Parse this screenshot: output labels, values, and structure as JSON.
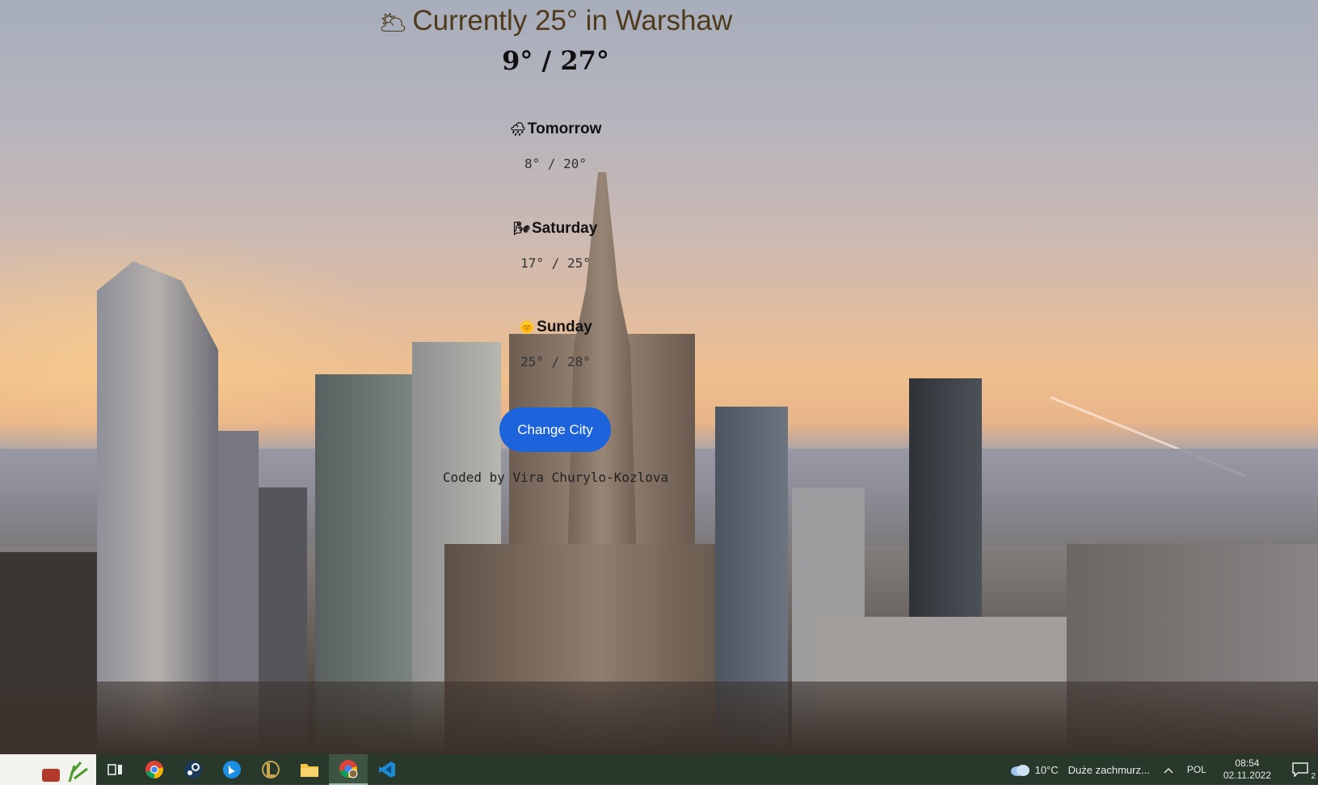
{
  "weather": {
    "current_text": "Currently 25° in Warshaw",
    "current_icon": "🌥",
    "today_range": "9° / 27°",
    "forecast": [
      {
        "icon": "🌧",
        "day": "Tomorrow",
        "temps": "8° / 20°"
      },
      {
        "icon": "🌬",
        "day": "Saturday",
        "temps": "17° / 25°"
      },
      {
        "icon": "🌞",
        "day": "Sunday",
        "temps": "25° / 28°"
      }
    ],
    "change_city_label": "Change City",
    "credit": "Coded by Vira Churylo-Kozlova"
  },
  "taskbar": {
    "apps": [
      "task-view-icon",
      "chrome-icon",
      "steam-icon",
      "bing-icon",
      "league-icon",
      "file-explorer-icon",
      "chrome-profile-icon",
      "vscode-icon"
    ],
    "active_app": "chrome-profile-icon",
    "weather_temp": "10°C",
    "weather_desc": "Duże zachmurz...",
    "language": "POL",
    "time": "08:54",
    "date": "02.11.2022",
    "notification_count": "2"
  }
}
